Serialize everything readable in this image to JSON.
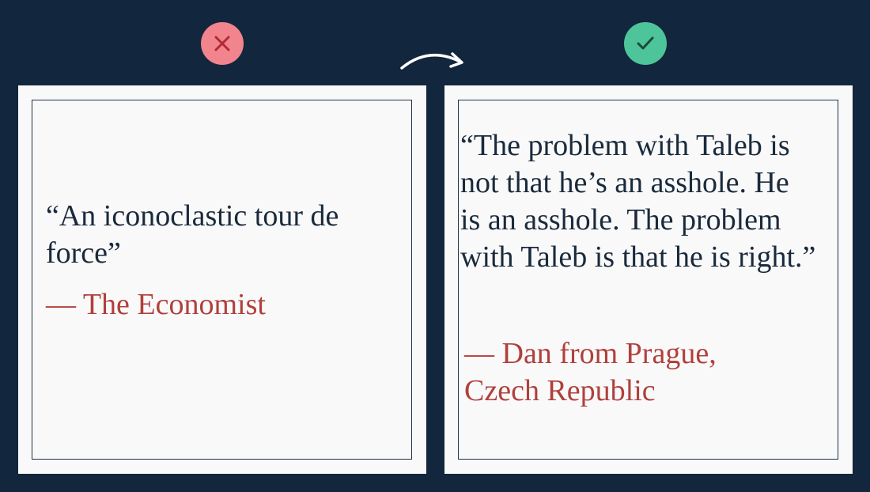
{
  "badges": {
    "bad": {
      "icon": "x-icon",
      "color": "#f2848e"
    },
    "good": {
      "icon": "check-icon",
      "color": "#4ec49a"
    }
  },
  "arrow": {
    "icon": "curved-arrow-right-icon"
  },
  "cards": {
    "left": {
      "quote": "“An iconoclastic tour de force”",
      "attribution": "— The Economist"
    },
    "right": {
      "quote": "“The problem with Taleb is not that he’s an asshole. He is an asshole. The problem with Taleb is that he is right.”",
      "attribution": "— Dan from Prague, Czech Republic"
    }
  },
  "colors": {
    "background": "#12263d",
    "card": "#f9f9f9",
    "quote_text": "#1a2a3c",
    "attribution_text": "#b0403c"
  }
}
